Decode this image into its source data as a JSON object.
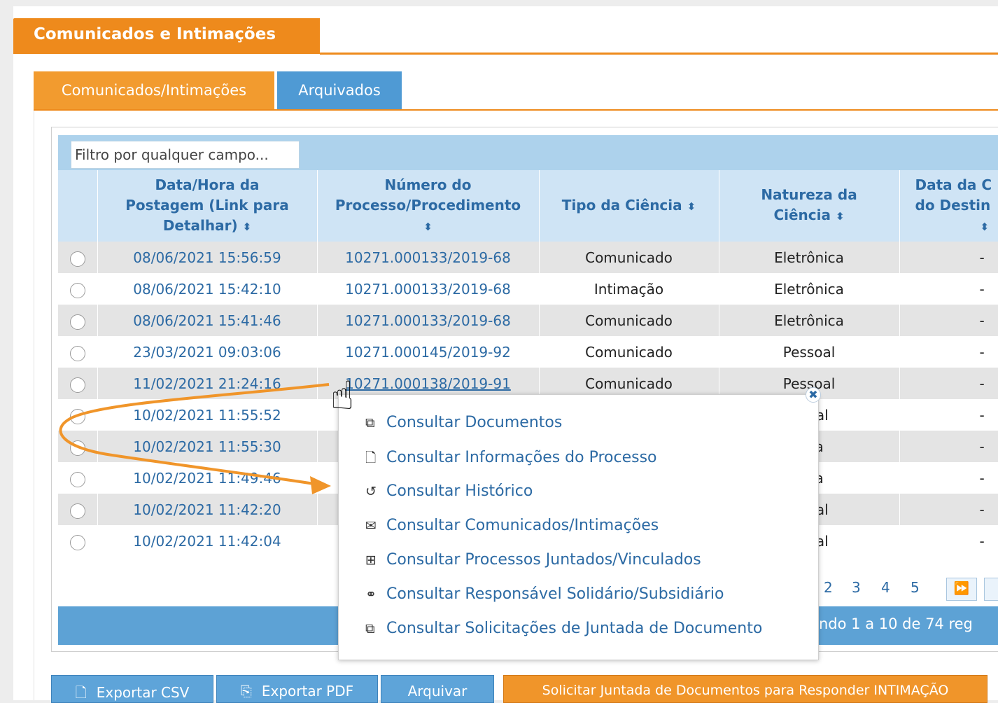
{
  "section": {
    "title": "Comunicados e Intimações"
  },
  "tabs": [
    {
      "label": "Comunicados/Intimações",
      "active": true
    },
    {
      "label": "Arquivados",
      "active": false
    }
  ],
  "filter": {
    "placeholder": "Filtro por qualquer campo..."
  },
  "table": {
    "headers": [
      "Data/Hora da Postagem (Link para Detalhar) ⬍",
      "Número do Processo/Procedimento ⬍",
      "Tipo da Ciência ⬍",
      "Natureza da Ciência ⬍",
      "Data da C do Destin ⬍"
    ],
    "header_lines": [
      [
        "Data/Hora da",
        "Postagem (Link para",
        "Detalhar)"
      ],
      [
        "Número do",
        "Processo/Procedimento",
        ""
      ],
      [
        "Tipo da Ciência"
      ],
      [
        "Natureza da",
        "Ciência"
      ],
      [
        "Data da C",
        "do Destin",
        ""
      ]
    ],
    "rows": [
      {
        "data": "08/06/2021 15:56:59",
        "processo": "10271.000133/2019-68",
        "tipo": "Comunicado",
        "natureza": "Eletrônica",
        "data_ciencia": "-"
      },
      {
        "data": "08/06/2021 15:42:10",
        "processo": "10271.000133/2019-68",
        "tipo": "Intimação",
        "natureza": "Eletrônica",
        "data_ciencia": "-"
      },
      {
        "data": "08/06/2021 15:41:46",
        "processo": "10271.000133/2019-68",
        "tipo": "Comunicado",
        "natureza": "Eletrônica",
        "data_ciencia": "-"
      },
      {
        "data": "23/03/2021 09:03:06",
        "processo": "10271.000145/2019-92",
        "tipo": "Comunicado",
        "natureza": "Pessoal",
        "data_ciencia": "-"
      },
      {
        "data": "11/02/2021 21:24:16",
        "processo": "10271.000138/2019-91",
        "tipo": "Comunicado",
        "natureza": "Pessoal",
        "data_ciencia": "-"
      },
      {
        "data": "10/02/2021 11:55:52",
        "processo": "",
        "tipo": "",
        "natureza": "anual",
        "data_ciencia": "-"
      },
      {
        "data": "10/02/2021 11:55:30",
        "processo": "",
        "tipo": "",
        "natureza": "nica",
        "data_ciencia": "-"
      },
      {
        "data": "10/02/2021 11:49:46",
        "processo": "",
        "tipo": "",
        "natureza": "nica",
        "data_ciencia": "-"
      },
      {
        "data": "10/02/2021 11:42:20",
        "processo": "",
        "tipo": "",
        "natureza": "anual",
        "data_ciencia": "-"
      },
      {
        "data": "10/02/2021 11:42:04",
        "processo": "",
        "tipo": "",
        "natureza": "anual",
        "data_ciencia": "-"
      }
    ]
  },
  "pager": {
    "pages": [
      "2",
      "3",
      "4",
      "5"
    ],
    "summary": "ndo 1 a 10 de 74 reg"
  },
  "context_menu": {
    "items": [
      {
        "label": "Consultar Documentos",
        "icon": "documents-icon"
      },
      {
        "label": "Consultar Informações do Processo",
        "icon": "file-icon"
      },
      {
        "label": "Consultar Histórico",
        "icon": "history-icon"
      },
      {
        "label": "Consultar Comunicados/Intimações",
        "icon": "envelope-icon"
      },
      {
        "label": "Consultar Processos Juntados/Vinculados",
        "icon": "linked-processes-icon"
      },
      {
        "label": "Consultar Responsável Solidário/Subsidiário",
        "icon": "handshake-icon"
      },
      {
        "label": "Consultar Solicitações de Juntada de Documento",
        "icon": "documents-request-icon"
      }
    ]
  },
  "buttons": {
    "export_csv": "Exportar CSV",
    "export_pdf": "Exportar PDF",
    "archive": "Arquivar",
    "request": "Solicitar Juntada de Documentos para Responder INTIMAÇÃO"
  },
  "colors": {
    "orange": "#ee8a1c",
    "blue": "#5da2d5",
    "link": "#2c6aa4",
    "header_bg": "#cfe4f5"
  }
}
